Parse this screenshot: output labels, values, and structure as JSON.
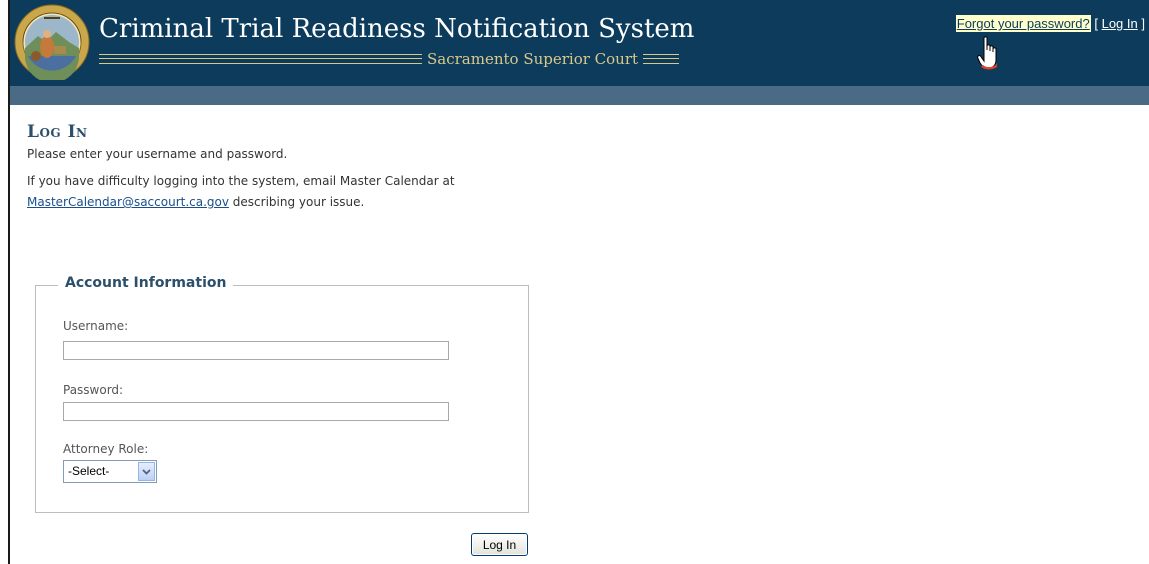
{
  "header": {
    "title": "Criminal Trial Readiness Notification System",
    "subtitle": "Sacramento Superior Court",
    "seal_text_top": "SUPERIOR COURT OF CALIFORNIA",
    "seal_text_bottom": "COUNTY OF SACRAMENTO",
    "seal_motto": "EUREKA"
  },
  "login_display": {
    "forgot_link": "Forgot your password?",
    "bracket_open": "[",
    "login_link": "Log In",
    "bracket_close": "]"
  },
  "main": {
    "heading": "Log In",
    "instruction": "Please enter your username and password.",
    "help_text_before": "If you have difficulty logging into the system, email Master Calendar at",
    "help_email": "MasterCalendar@saccourt.ca.gov",
    "help_text_after": "describing your issue."
  },
  "account_info": {
    "legend": "Account Information",
    "username_label": "Username:",
    "username_value": "",
    "password_label": "Password:",
    "password_value": "",
    "role_label": "Attorney Role:",
    "role_selected": "-Select-"
  },
  "actions": {
    "login_button": "Log In"
  },
  "colors": {
    "header_bg": "#0d3b5c",
    "subbar_bg": "#4a6a86",
    "accent_gold": "#d8c98a",
    "heading_color": "#2c4f6b",
    "link_highlight": "#ffffcc"
  }
}
